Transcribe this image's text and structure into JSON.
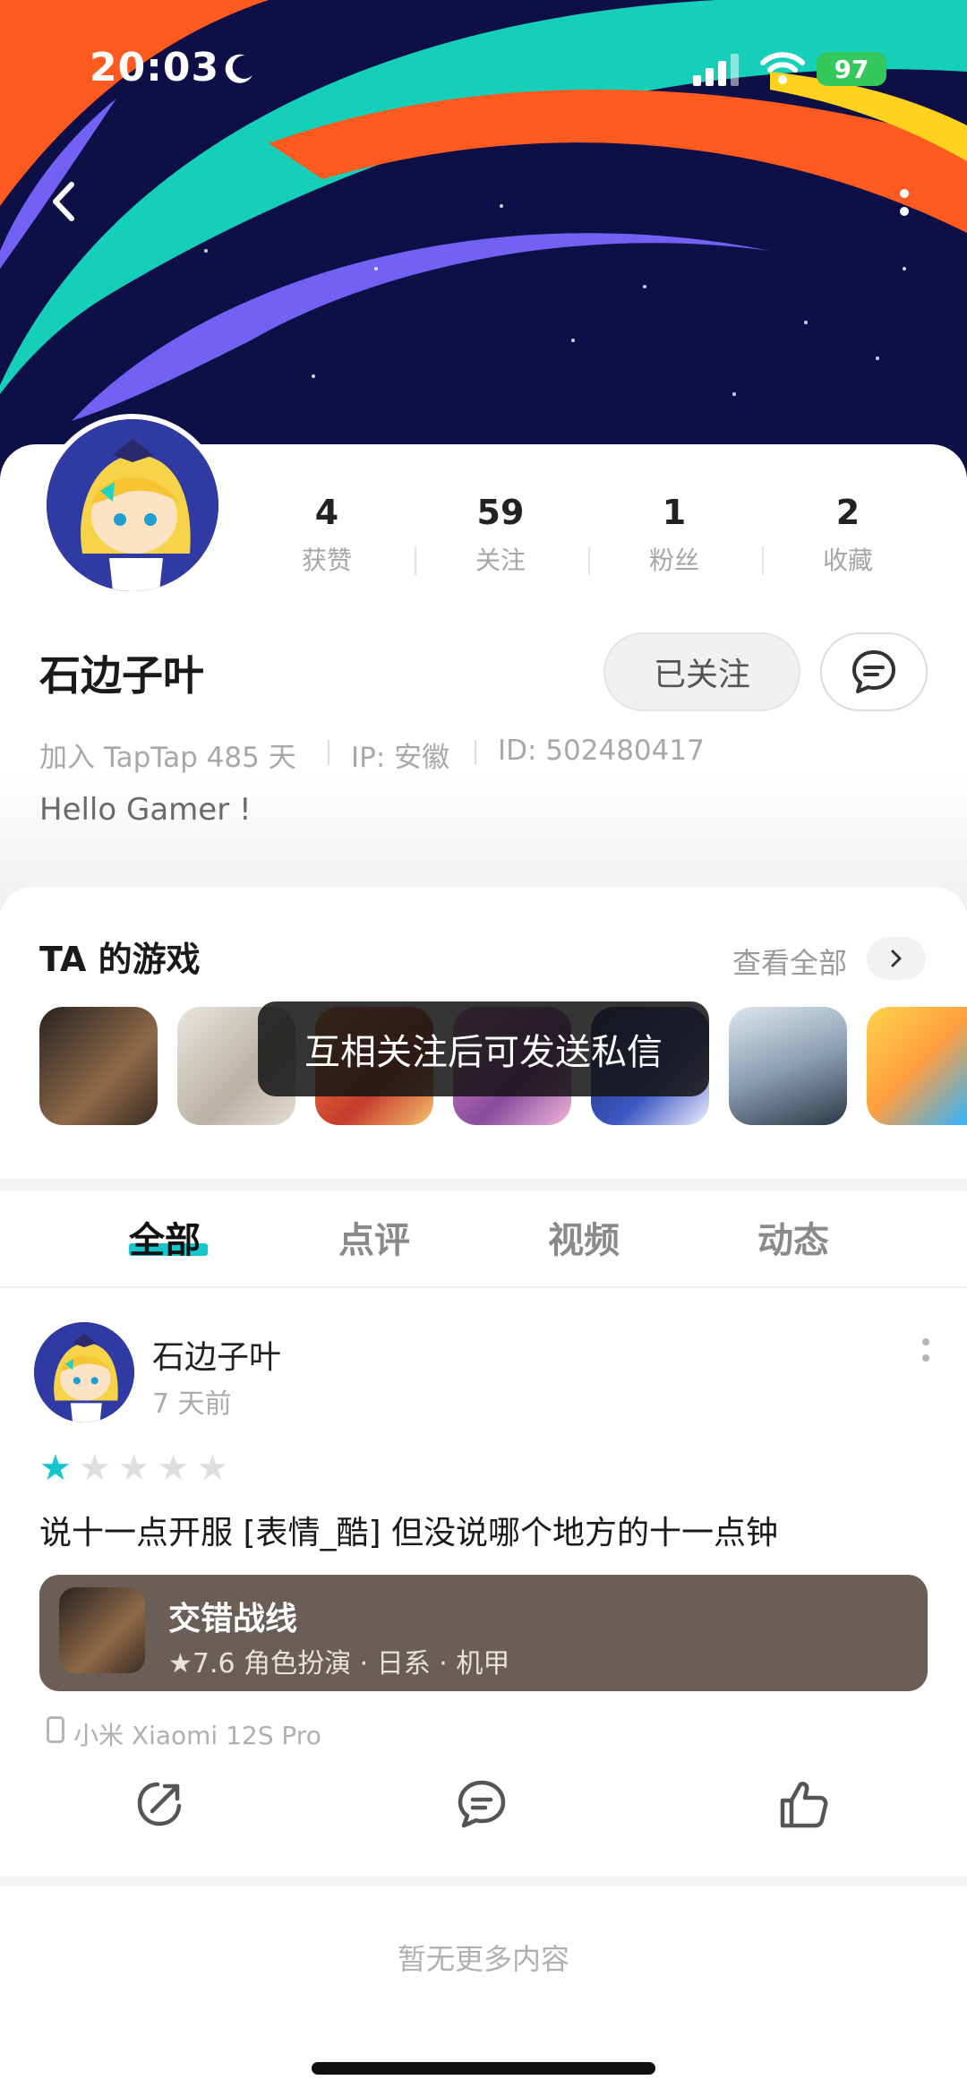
{
  "status_bar": {
    "time": "20:03",
    "battery": "97"
  },
  "profile": {
    "stats": [
      {
        "value": "4",
        "label": "获赞"
      },
      {
        "value": "59",
        "label": "关注"
      },
      {
        "value": "1",
        "label": "粉丝"
      },
      {
        "value": "2",
        "label": "收藏"
      }
    ],
    "name": "石边子叶",
    "follow_label": "已关注",
    "meta_days": "加入 TapTap 485 天",
    "meta_ip": "IP: 安徽",
    "meta_id": "ID: 502480417",
    "bio": "Hello Gamer !"
  },
  "games": {
    "title": "TA 的游戏",
    "view_all": "查看全部"
  },
  "toast": "互相关注后可发送私信",
  "tabs": [
    "全部",
    "点评",
    "视频",
    "动态"
  ],
  "post": {
    "author": "石边子叶",
    "time": "7 天前",
    "rating": 1,
    "rating_max": 5,
    "text": "说十一点开服 [表情_酷] 但没说哪个地方的十一点钟",
    "game_name": "交错战线",
    "game_meta": "★7.6  角色扮演 · 日系 · 机甲",
    "device": "小米 Xiaomi 12S Pro"
  },
  "no_more": "暂无更多内容",
  "colors": {
    "accent": "#15c5ce",
    "banner_bg": "#0e0f46",
    "card_bg": "#6a5e57"
  }
}
